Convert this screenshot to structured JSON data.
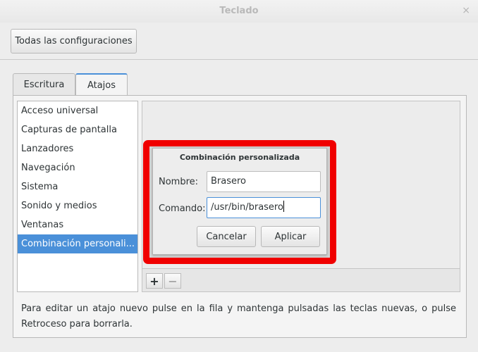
{
  "window": {
    "title": "Teclado",
    "close_glyph": "×"
  },
  "header": {
    "all_settings_label": "Todas las configuraciones"
  },
  "tabs": [
    {
      "label": "Escritura",
      "active": false
    },
    {
      "label": "Atajos",
      "active": true
    }
  ],
  "categories": [
    {
      "label": "Acceso universal"
    },
    {
      "label": "Capturas de pantalla"
    },
    {
      "label": "Lanzadores"
    },
    {
      "label": "Navegación"
    },
    {
      "label": "Sistema"
    },
    {
      "label": "Sonido y medios"
    },
    {
      "label": "Ventanas"
    },
    {
      "label": "Combinación personali...",
      "selected": true
    }
  ],
  "toolbar": {
    "add_glyph": "+",
    "remove_glyph": "−"
  },
  "hint": "Para editar un atajo nuevo pulse en la fila y mantenga pulsadas las teclas nuevas, o pulse Retroceso para borrarla.",
  "dialog": {
    "title": "Combinación personalizada",
    "name_label": "Nombre:",
    "name_value": "Brasero",
    "command_label": "Comando:",
    "command_value": "/usr/bin/brasero",
    "cancel_label": "Cancelar",
    "apply_label": "Aplicar"
  },
  "colors": {
    "accent": "#4a90d9",
    "highlight": "#f00000"
  }
}
